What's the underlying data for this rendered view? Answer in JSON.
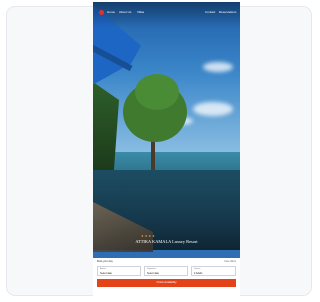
{
  "nav": {
    "links": [
      "Home",
      "About Us",
      "Villas"
    ],
    "right": [
      "Contact",
      "Reservations"
    ]
  },
  "hero": {
    "stars": "★★★★",
    "title": "ATTIKA KAMALA Luxury Resort"
  },
  "booking": {
    "label": "Book your stay",
    "link": "View offers",
    "fields": [
      {
        "label": "Arrival",
        "value": "Select date"
      },
      {
        "label": "Departure",
        "value": "Select date"
      },
      {
        "label": "Guests",
        "value": "2 Adults"
      }
    ],
    "cta": "Check Availability"
  },
  "colors": {
    "accent": "#e4431a",
    "brand": "#e4312b"
  }
}
